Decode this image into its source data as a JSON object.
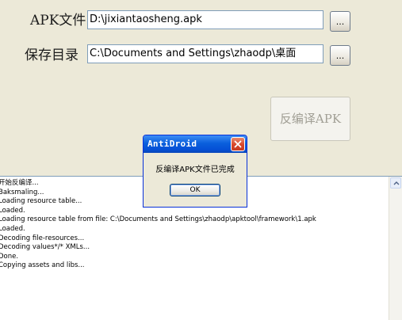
{
  "form": {
    "apk_label": "APK文件",
    "apk_value": "D:\\jixiantaosheng.apk",
    "apk_browse_label": "...",
    "save_label": "保存目录",
    "save_value": "C:\\Documents and Settings\\zhaodp\\桌面",
    "save_browse_label": "..."
  },
  "actions": {
    "decompile_label": "反编译APK"
  },
  "dialog": {
    "title": "AntiDroid",
    "message": "反编译APK文件已完成",
    "ok_label": "OK"
  },
  "log": {
    "lines": [
      "开始反编译...",
      "Baksmaling...",
      "Loading resource table...",
      "Loaded.",
      "Loading resource table from file: C:\\Documents and Settings\\zhaodp\\apktool\\framework\\1.apk",
      "Loaded.",
      "Decoding file-resources...",
      "Decoding values*/* XMLs...",
      "Done.",
      "Copying assets and libs..."
    ]
  },
  "icons": {
    "close": "close-icon",
    "scroll_up": "chevron-up-icon"
  },
  "colors": {
    "window_bg": "#ece9d8",
    "titlebar": "#0a5fdc",
    "close_button": "#d7462b",
    "input_border": "#7f9db9"
  }
}
